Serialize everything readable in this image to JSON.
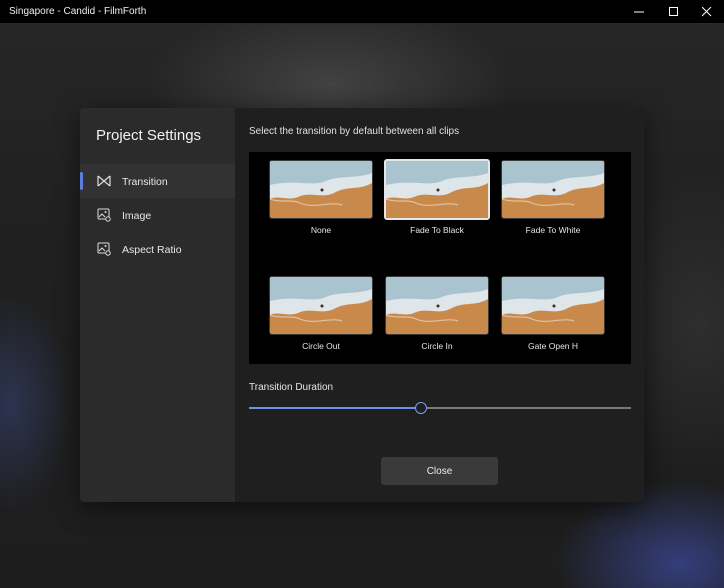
{
  "window": {
    "title": "Singapore - Candid - FilmForth"
  },
  "dialog": {
    "heading": "Project Settings",
    "nav": [
      {
        "label": "Transition",
        "icon": "bowtie-icon",
        "active": true
      },
      {
        "label": "Image",
        "icon": "image-settings-icon",
        "active": false
      },
      {
        "label": "Aspect Ratio",
        "icon": "image-settings-icon",
        "active": false
      }
    ],
    "instruction": "Select the transition by default between all clips",
    "transitions": [
      {
        "label": "None",
        "selected": false
      },
      {
        "label": "Fade To Black",
        "selected": true
      },
      {
        "label": "Fade To White",
        "selected": false
      },
      {
        "label": "Circle Out",
        "selected": false
      },
      {
        "label": "Circle In",
        "selected": false
      },
      {
        "label": "Gate Open H",
        "selected": false
      }
    ],
    "duration": {
      "label": "Transition Duration",
      "value_fraction": 0.45
    },
    "close_label": "Close"
  },
  "colors": {
    "accent": "#6f8ee8",
    "sand": "#c9894a",
    "foam": "#dfe6ea"
  }
}
